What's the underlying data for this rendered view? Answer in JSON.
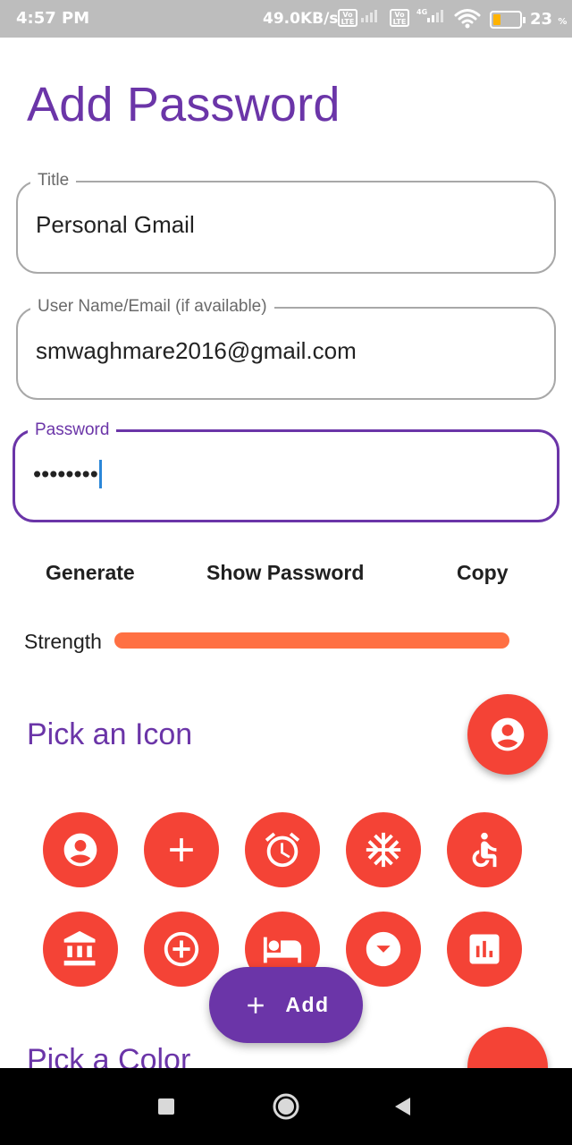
{
  "status_bar": {
    "time": "4:57 PM",
    "network_speed": "49.0KB/s",
    "sim1_badge": "Vo LTE",
    "sim2_badge": "Vo LTE",
    "sim2_network": "4G",
    "battery_percent": "23",
    "battery_suffix": "%"
  },
  "page": {
    "title": "Add Password"
  },
  "form": {
    "title_field": {
      "label": "Title",
      "value": "Personal Gmail"
    },
    "username_field": {
      "label": "User Name/Email (if available)",
      "value": "smwaghmare2016@gmail.com"
    },
    "password_field": {
      "label": "Password",
      "value": "••••••••"
    }
  },
  "actions": {
    "generate": "Generate",
    "show_password": "Show Password",
    "copy": "Copy"
  },
  "strength": {
    "label": "Strength",
    "level": 1.0,
    "color": "#ff7043"
  },
  "icon_section": {
    "title": "Pick an Icon",
    "selected_icon": "account-circle-icon",
    "icons": [
      "account-circle-icon",
      "add-icon",
      "alarm-icon",
      "snowflake-icon",
      "accessible-icon",
      "bank-icon",
      "add-circle-icon",
      "hotel-bed-icon",
      "arrow-drop-down-circle-icon",
      "bar-chart-icon"
    ]
  },
  "color_section": {
    "title": "Pick a Color",
    "selected_color": "#f44336"
  },
  "add_button": {
    "label": "Add"
  },
  "colors": {
    "accent": "#6b35a8",
    "icon_red": "#f44336",
    "cursor": "#2b87d8"
  }
}
